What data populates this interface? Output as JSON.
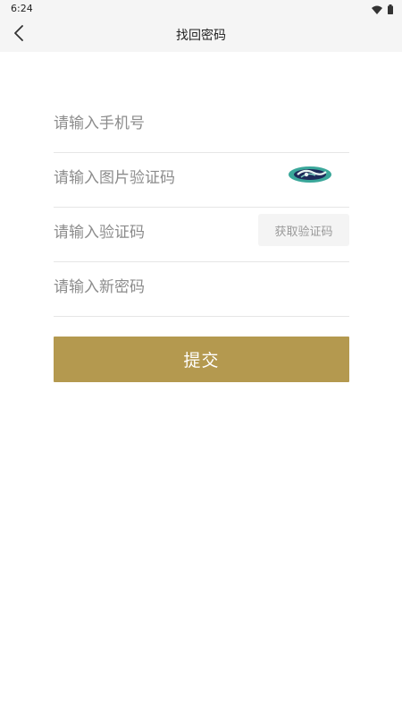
{
  "status_bar": {
    "time": "6:24",
    "icons": [
      "wifi-icon",
      "battery-icon"
    ]
  },
  "app_bar": {
    "title": "找回密码",
    "back_icon": "chevron-left-icon"
  },
  "form": {
    "phone": {
      "placeholder": "请输入手机号",
      "value": ""
    },
    "image_code": {
      "placeholder": "请输入图片验证码",
      "value": "",
      "captcha_icon": "captcha-image"
    },
    "sms_code": {
      "placeholder": "请输入验证码",
      "value": "",
      "button_label": "获取验证码"
    },
    "new_password": {
      "placeholder": "请输入新密码",
      "value": ""
    }
  },
  "submit": {
    "label": "提交"
  },
  "colors": {
    "accent": "#b4994f",
    "bar_bg": "#f5f5f5",
    "placeholder": "#8c8c8c",
    "divider": "#e6e6e6"
  }
}
